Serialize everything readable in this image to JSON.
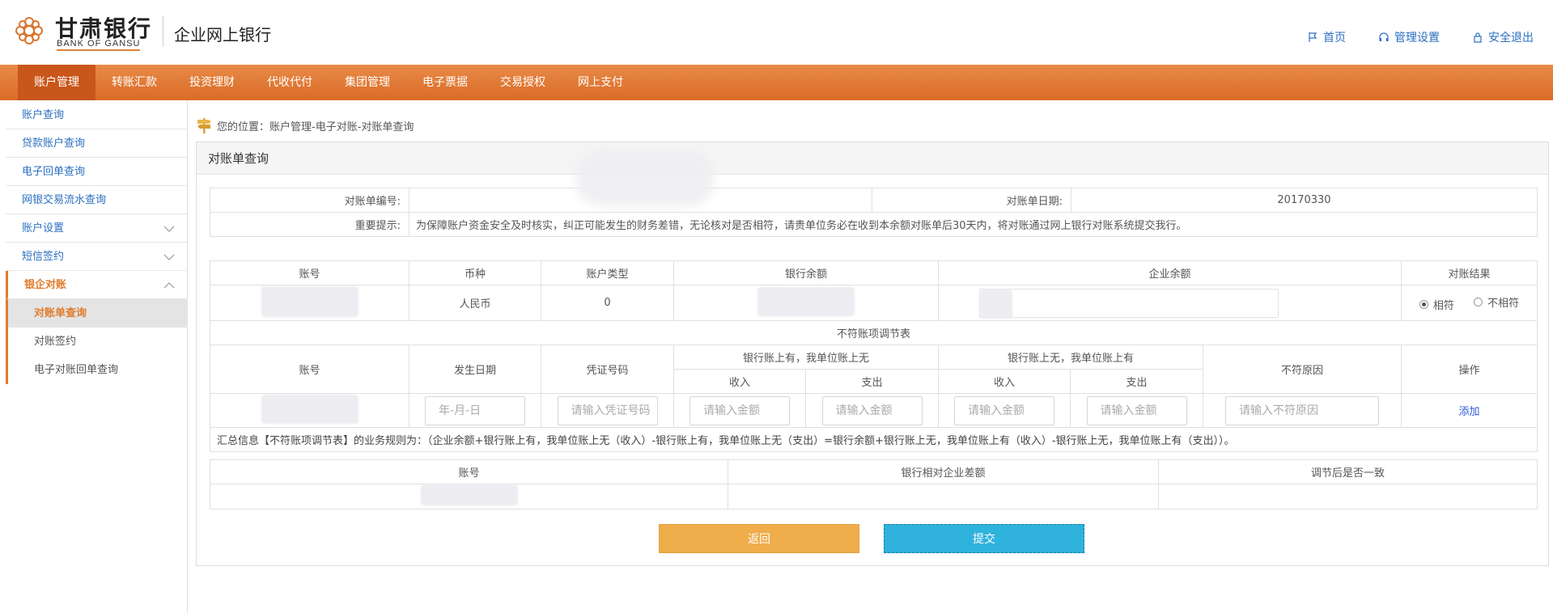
{
  "header": {
    "bank_name_cn": "甘肃银行",
    "bank_name_en": "BANK OF GANSU",
    "app_title": "企业网上银行",
    "links": [
      {
        "label": "首页",
        "icon": "flag-icon"
      },
      {
        "label": "管理设置",
        "icon": "headset-icon"
      },
      {
        "label": "安全退出",
        "icon": "lock-icon"
      }
    ]
  },
  "nav": {
    "items": [
      "账户管理",
      "转账汇款",
      "投资理财",
      "代收代付",
      "集团管理",
      "电子票据",
      "交易授权",
      "网上支付"
    ],
    "active_index": 0
  },
  "sidebar": {
    "items": [
      "账户查询",
      "贷款账户查询",
      "电子回单查询",
      "网银交易流水查询",
      "账户设置",
      "短信签约",
      "银企对账"
    ],
    "subitems": [
      "对账单查询",
      "对账签约",
      "电子对账回单查询"
    ],
    "active_sub": "对账单查询"
  },
  "breadcrumb": "您的位置：账户管理-电子对账-对账单查询",
  "panel": {
    "title": "对账单查询",
    "info": {
      "statement_no_label": "对账单编号:",
      "statement_no": "",
      "statement_date_label": "对账单日期:",
      "statement_date": "20170330",
      "notice_label": "重要提示:",
      "notice": "为保障账户资金安全及时核实，纠正可能发生的财务差错，无论核对是否相符，请贵单位务必在收到本余额对账单后30天内，将对账通过网上银行对账系统提交我行。"
    },
    "balance_table": {
      "headers": [
        "账号",
        "币种",
        "账户类型",
        "银行余额",
        "企业余额",
        "对账结果"
      ],
      "row": {
        "currency": "人民币",
        "account_type": "0"
      },
      "result_options": [
        "相符",
        "不相符"
      ],
      "selected_result": "相符"
    },
    "adjust_table": {
      "title": "不符账项调节表",
      "headers": {
        "account": "账号",
        "date": "发生日期",
        "voucher": "凭证号码",
        "bank_has": "银行账上有，我单位账上无",
        "bank_not": "银行账上无，我单位账上有",
        "income": "收入",
        "expense": "支出",
        "reason": "不符原因",
        "action": "操作"
      },
      "placeholders": {
        "date": "年-月-日",
        "voucher": "请输入凭证号码",
        "amount": "请输入金额",
        "reason": "请输入不符原因"
      },
      "add_label": "添加"
    },
    "summary": "汇总信息【不符账项调节表】的业务规则为：（企业余额+银行账上有，我单位账上无（收入）-银行账上有，我单位账上无（支出）=银行余额+银行账上无，我单位账上有（收入）-银行账上无，我单位账上有（支出））。",
    "summary_table": {
      "headers": [
        "账号",
        "银行相对企业差额",
        "调节后是否一致"
      ]
    },
    "buttons": {
      "back": "返回",
      "submit": "提交"
    }
  }
}
